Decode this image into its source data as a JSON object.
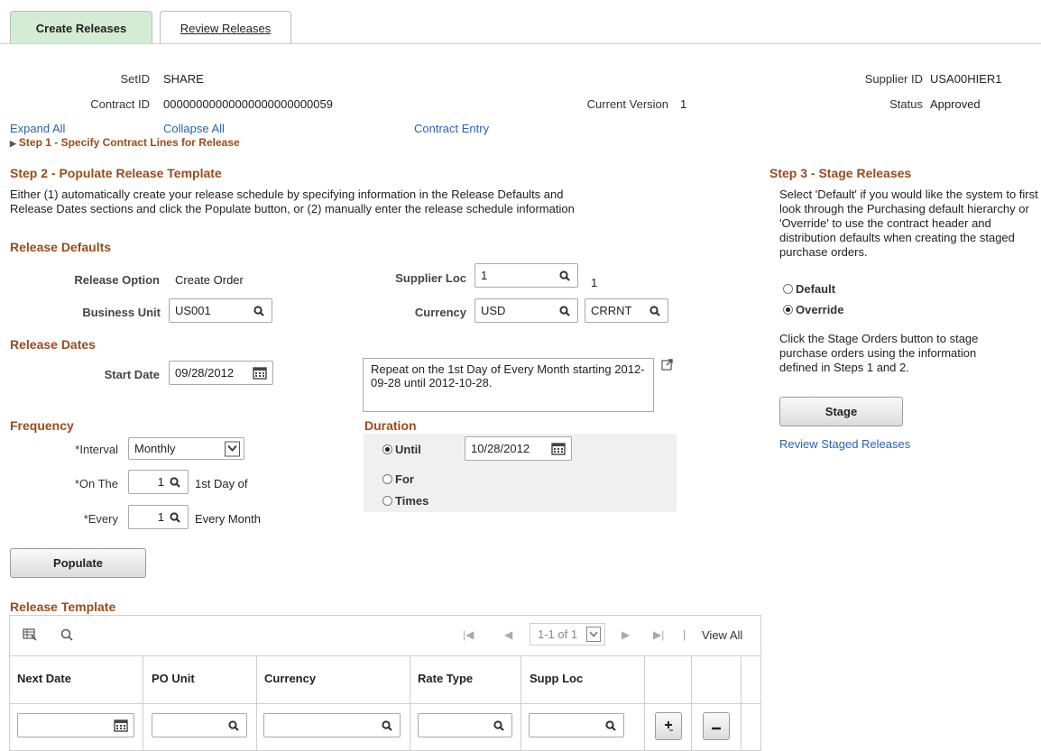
{
  "tabs": [
    {
      "label": "Create Releases",
      "active": true
    },
    {
      "label": "Review Releases",
      "active": false
    }
  ],
  "header": {
    "setid_label": "SetID",
    "setid_value": "SHARE",
    "supplier_id_label": "Supplier ID",
    "supplier_id_value": "USA00HIER1",
    "contract_id_label": "Contract ID",
    "contract_id_value": "00000000000000000000000059",
    "current_version_label": "Current Version",
    "current_version_value": "1",
    "status_label": "Status",
    "status_value": "Approved"
  },
  "links": {
    "expand_all": "Expand All",
    "collapse_all": "Collapse All",
    "contract_entry": "Contract Entry",
    "step1": "Step 1 - Specify Contract Lines for Release"
  },
  "step2": {
    "title": "Step 2 - Populate Release Template",
    "description": "Either (1) automatically create your release schedule by specifying information in the Release Defaults and Release Dates sections and click the Populate button, or (2) manually enter the release schedule information"
  },
  "release_defaults": {
    "title": "Release Defaults",
    "release_option_label": "Release Option",
    "release_option_value": "Create Order",
    "business_unit_label": "Business Unit",
    "business_unit_value": "US001",
    "supplier_loc_label": "Supplier Loc",
    "supplier_loc_value": "1",
    "supplier_loc_desc": "1",
    "currency_label": "Currency",
    "currency_value": "USD",
    "rate_type_value": "CRRNT"
  },
  "release_dates": {
    "title": "Release Dates",
    "start_date_label": "Start Date",
    "start_date_value": "09/28/2012",
    "summary": "Repeat on the 1st Day of Every Month starting 2012-09-28 until 2012-10-28."
  },
  "frequency": {
    "title": "Frequency",
    "interval_label": "*Interval",
    "interval_value": "Monthly",
    "on_the_label": "*On The",
    "on_the_value": "1",
    "on_the_desc": "1st Day of",
    "every_label": "*Every",
    "every_value": "1",
    "every_desc": "Every Month"
  },
  "duration": {
    "title": "Duration",
    "until_label": "Until",
    "until_value": "10/28/2012",
    "until_selected": true,
    "for_label": "For",
    "times_label": "Times"
  },
  "populate_button": "Populate",
  "step3": {
    "title": "Step 3 - Stage Releases",
    "description": "Select 'Default' if you would like the system to first look through the Purchasing default hierarchy or 'Override' to use the contract header and distribution defaults when creating the staged purchase orders.",
    "default_label": "Default",
    "override_label": "Override",
    "override_selected": true,
    "stage_info": "Click the Stage Orders button to stage purchase orders using the information defined in Steps 1 and 2.",
    "stage_button": "Stage",
    "review_link": "Review Staged Releases"
  },
  "release_template": {
    "title": "Release Template",
    "pager_text": "1-1 of 1",
    "view_all": "View All",
    "columns": [
      "Next Date",
      "PO Unit",
      "Currency",
      "Rate Type",
      "Supp Loc"
    ]
  },
  "colors": {
    "section_title": "#9a4b1a",
    "link": "#2a62b5",
    "active_tab": "#d4ecd4"
  }
}
